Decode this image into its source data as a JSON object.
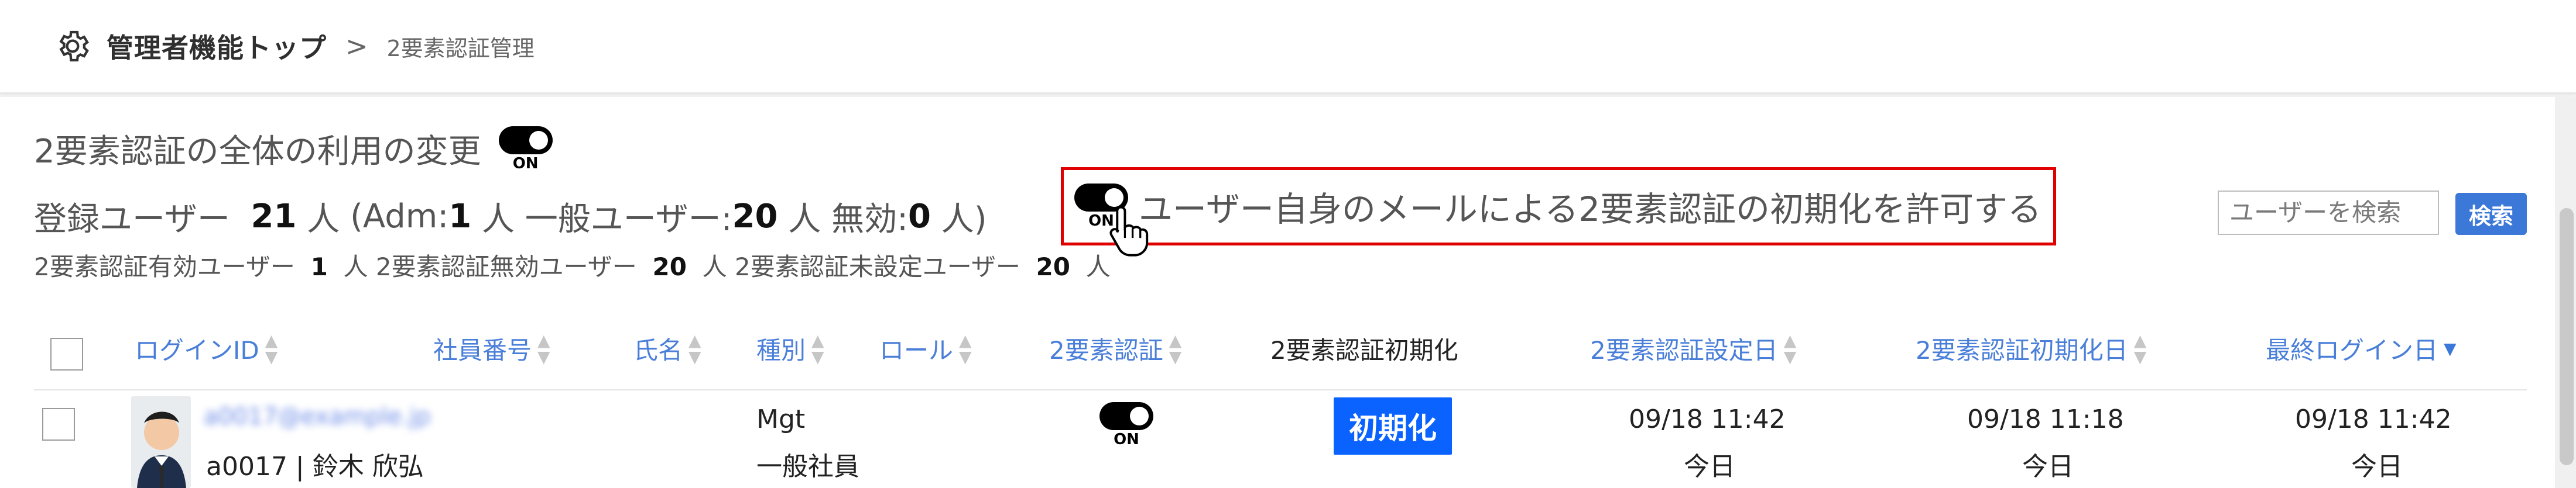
{
  "breadcrumb": {
    "root": "管理者機能トップ",
    "separator": ">",
    "current": "2要素認証管理"
  },
  "section": {
    "title": "2要素認証の全体の利用の変更",
    "global_toggle": {
      "label": "ON",
      "state": true
    }
  },
  "counts": {
    "prefix": "登録ユーザー",
    "registered": "21",
    "unit": "人",
    "adm_prefix": "(Adm:",
    "adm": "1",
    "general_prefix": "人 一般ユーザー:",
    "general": "20",
    "invalid_prefix": "人 無効:",
    "invalid": "0",
    "suffix": "人)"
  },
  "stats": {
    "enabled_label": "2要素認証有効ユーザー",
    "enabled": "1",
    "disabled_label": "人 2要素認証無効ユーザー",
    "disabled": "20",
    "unset_label": "人 2要素認証未設定ユーザー",
    "unset": "20",
    "unit": "人"
  },
  "allow_reset": {
    "label": "ユーザー自身のメールによる2要素認証の初期化を許可する",
    "toggle_label": "ON",
    "state": true
  },
  "search": {
    "placeholder": "ユーザーを検索",
    "button": "検索"
  },
  "table": {
    "columns": [
      {
        "label": "ログインID"
      },
      {
        "label": "社員番号"
      },
      {
        "label": "氏名"
      },
      {
        "label": "種別"
      },
      {
        "label": "ロール"
      },
      {
        "label": "2要素認証"
      },
      {
        "label": "2要素認証初期化"
      },
      {
        "label": "2要素認証設定日"
      },
      {
        "label": "2要素認証初期化日"
      },
      {
        "label": "最終ログイン日"
      }
    ],
    "rows": [
      {
        "email": "a0017@example.jp",
        "id_name": "a0017 | 鈴木 欣弘",
        "type": "Mgt",
        "role": "一般社員",
        "twofa": "ON",
        "reset_button": "初期化",
        "set_date": "09/18 11:42",
        "set_date_sub": "今日",
        "reset_date": "09/18 11:18",
        "reset_date_sub": "今日",
        "last_login": "09/18 11:42",
        "last_login_sub": "今日"
      }
    ]
  },
  "colors": {
    "link": "#4a7fd9",
    "primary_button": "#0a63ff",
    "search_button": "#3c78d8",
    "highlight_border": "#e00000"
  }
}
